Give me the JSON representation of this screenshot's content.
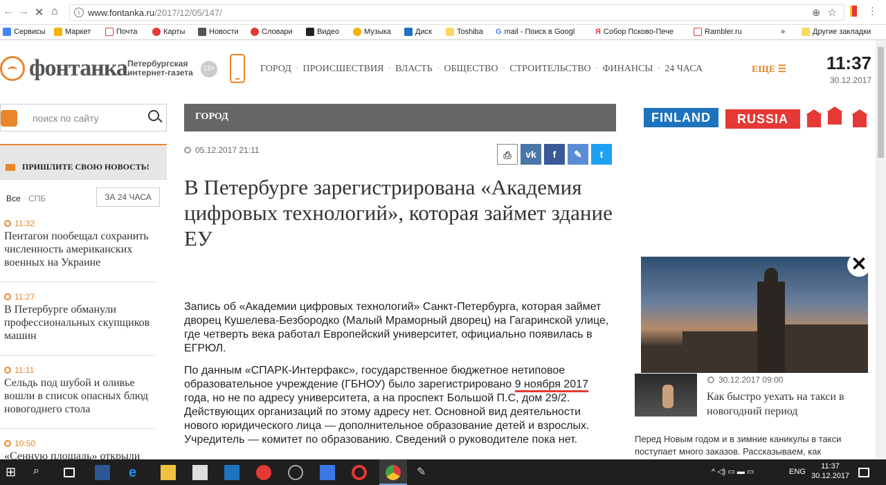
{
  "browser": {
    "url_host": "www.fontanka.ru",
    "url_path": "/2017/12/05/147/",
    "bookmarks": [
      "Сервисы",
      "Маркет",
      "Почта",
      "Карты",
      "Новости",
      "Словари",
      "Видео",
      "Музыка",
      "Диск",
      "Toshiba",
      "mail - Поиск в Googl",
      "Собор Псково-Пече",
      "Rambler.ru",
      "»",
      "Другие закладки"
    ]
  },
  "header": {
    "logo": "фонтанка",
    "logo_sub_line1": "Петербургская",
    "logo_sub_line2": "интернет-газета",
    "age_badge": "18+",
    "nav": [
      "ГОРОД",
      "ПРОИСШЕСТВИЯ",
      "ВЛАСТЬ",
      "ОБЩЕСТВО",
      "СТРОИТЕЛЬСТВО",
      "ФИНАНСЫ",
      "24 ЧАСА"
    ],
    "more_label": "ЕЩЕ ☰",
    "time": "11:37",
    "date": "30.12.2017"
  },
  "sidebar": {
    "search_placeholder": "поиск по сайту",
    "submit_news": "ПРИШЛИТЕ СВОЮ НОВОСТЬ!",
    "tab_all": "Все",
    "tab_spb": "СПБ",
    "tab_24": "ЗА 24 ЧАСА",
    "news": [
      {
        "time": "11:32",
        "title": "Пентагон пообещал сохранить численность американских военных на Украине"
      },
      {
        "time": "11:27",
        "title": "В Петербурге обманули профессиональных скупщиков машин"
      },
      {
        "time": "11:11",
        "title": "Сельдь под шубой и оливье вошли в список опасных блюд новогоднего стола"
      },
      {
        "time": "10:50",
        "title": "«Сенную площадь» открыли после проверки"
      }
    ]
  },
  "article": {
    "section": "ГОРОД",
    "date": "05.12.2017 21:11",
    "headline": "В Петербурге зарегистрирована «Академия цифровых технологий», которая займет здание ЕУ",
    "p1": "Запись об «Академии цифровых технологий» Санкт-Петербурга, которая займет дворец Кушелева-Безбородко (Малый Мраморный дворец) на Гагаринской улице, где четверть века работал Европейский университет, официально появилась в ЕГРЮЛ.",
    "p2_before": "По данным «СПАРК-Интерфакс», государственное бюджетное нетиповое образовательное учреждение (ГБНОУ) было зарегистрировано ",
    "p2_highlight": "9 ноября 2017",
    "p2_after": " года, но не по адресу университета, а на проспект Большой П.С, дом 29/2. Действующих организаций по этому адресу нет. Основной вид деятельности нового юридического лица — дополнительное образование детей и взрослых. Учредитель — комитет по образованию. Сведений о руководителе пока нет.",
    "share": {
      "vk": "vk",
      "fb": "f",
      "lj": "✎",
      "tw": "t"
    }
  },
  "rightcol": {
    "banner_finland": "FINLAND",
    "banner_russia": "RUSSIA",
    "promo_date": "30.12.2017 09:00",
    "promo_title": "Как быстро уехать на такси в новогодний период",
    "promo_text": "Перед Новым годом и в зимние каникулы в такси поступает много заказов. Рассказываем, как"
  },
  "taskbar": {
    "lang": "ENG",
    "time": "11:37",
    "date": "30.12.2017"
  },
  "colors": {
    "brand_orange": "#e8862c",
    "section_gray": "#666666",
    "underline_red": "#e53935"
  }
}
